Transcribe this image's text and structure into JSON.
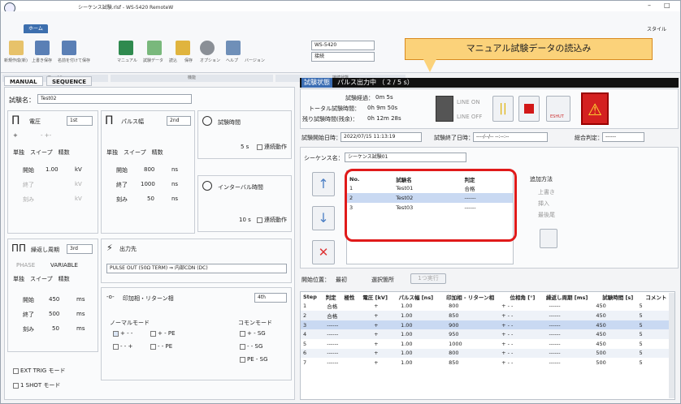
{
  "window": {
    "title": "シーケンス試験.rlsf - WS-5420 RemoteW",
    "style_menu": "スタイル",
    "home_tab": "ホーム"
  },
  "ribbon": {
    "labels": [
      "新規作成(新)",
      "上書き保存",
      "名前を付けて保存",
      "マニュアル",
      "試験データ",
      "読込",
      "保存",
      "オプション",
      "ヘルプ",
      "バージョン"
    ],
    "model_value": "WS-5420",
    "status_value": "接続",
    "groups": [
      "ファイル",
      "機能",
      "接続状態"
    ]
  },
  "callout": "マニュアル試験データの読込み",
  "left": {
    "tabs": [
      "MANUAL",
      "SEQUENCE"
    ],
    "test_name_label": "試験名：",
    "test_name_value": "Test02",
    "voltage": {
      "title": "電圧",
      "select": "1st",
      "mode_on": "+",
      "mode_off": "- +-",
      "sweep_tabs": "単独　スイープ　精数",
      "start_label": "開始",
      "start_value": "1.00",
      "start_unit": "kV",
      "end_label": "終了",
      "end_unit": "kV",
      "step_label": "刻み",
      "step_unit": "kV"
    },
    "pulse": {
      "title": "パルス幅",
      "select": "2nd",
      "sweep_tabs": "単独　スイープ　精数",
      "start_label": "開始",
      "start_value": "800",
      "start_unit": "ns",
      "end_label": "終了",
      "end_value": "1000",
      "end_unit": "ns",
      "step_label": "刻み",
      "step_unit": "ns",
      "step_value": "50"
    },
    "test_time": {
      "title": "試験時間",
      "value": "5 s",
      "cont": "連続動作"
    },
    "interval": {
      "title": "インターバル時間",
      "value": "10 s",
      "cont": "連続動作"
    },
    "period": {
      "title": "繰返し周期",
      "select": "3rd",
      "phase": "PHASE",
      "variable": "VARIABLE",
      "sweep_tabs": "単独　スイープ　精数",
      "start_label": "開始",
      "start_value": "450",
      "start_unit": "ms",
      "end_label": "終了",
      "end_value": "500",
      "end_unit": "ms",
      "step_label": "刻み",
      "step_value": "50",
      "step_unit": "ms"
    },
    "output": {
      "title": "出力先",
      "value": "PULSE OUT (50Ω TERM) ⇒ 内部CDN (DC)"
    },
    "switch": {
      "title": "印加相・リターン相",
      "select": "4th",
      "normal_mode": "ノーマルモード",
      "common_mode": "コモンモード",
      "n1": "+ - -",
      "n2": "+ - PE",
      "n3": "- - +",
      "n4": "- - PE",
      "c1": "+ - SG",
      "c2": "- - SG",
      "c3": "PE - SG"
    },
    "ext_trig": "EXT TRIG モード",
    "one_shot": "1 SHOT モード"
  },
  "right": {
    "status_label": "試験状態",
    "status_value": "パルス出力中 （ 2 / 5 s）",
    "elapsed_label": "試験経過：",
    "elapsed_value": "0m  5s",
    "total_label": "トータル試験時間：",
    "total_value": "0h  9m  50s",
    "remain_label": "残り試験時間(残余)：",
    "remain_value": "0h  12m  28s",
    "line_on": "LINE ON",
    "line_off": "LINE OFF",
    "eshut": "ESHUT",
    "start_dt_label": "試験開始日時：",
    "start_dt_value": "2022/07/15 11:13:19",
    "end_dt_label": "試験終了日時：",
    "end_dt_value": "----/--/-- --:--:--",
    "judge_label": "総合判定：",
    "judge_value": "------",
    "seq_label": "シーケンス名：",
    "seq_value": "シーケンス試験01",
    "seq_cols": [
      "No.",
      "試験名",
      "判定"
    ],
    "seq_rows": [
      [
        "1",
        "Test01",
        "合格"
      ],
      [
        "2",
        "Test02",
        "------"
      ],
      [
        "3",
        "Test03",
        "------"
      ]
    ],
    "add_method": "追加方法",
    "add_options": [
      "上書き",
      "挿入",
      "最後尾"
    ],
    "start_pos_label": "開始位置：",
    "start_pos_first": "最初",
    "start_pos_sel": "選択箇所",
    "single_btn": "1つ実行",
    "step_cols": [
      "Step",
      "判定",
      "極性",
      "電圧 [kV]",
      "パルス幅 [ns]",
      "印加相 - リターン相",
      "位相角 [°]",
      "繰返し周期 [ms]",
      "試験時間 [s]",
      "コメント"
    ],
    "step_rows": [
      [
        "1",
        "合格",
        "+",
        "1.00",
        "800",
        "+ - -",
        "------",
        "450",
        "5",
        ""
      ],
      [
        "2",
        "合格",
        "+",
        "1.00",
        "850",
        "+ - -",
        "------",
        "450",
        "5",
        ""
      ],
      [
        "3",
        "------",
        "+",
        "1.00",
        "900",
        "+ - -",
        "------",
        "450",
        "5",
        ""
      ],
      [
        "4",
        "------",
        "+",
        "1.00",
        "950",
        "+ - -",
        "------",
        "450",
        "5",
        ""
      ],
      [
        "5",
        "------",
        "+",
        "1.00",
        "1000",
        "+ - -",
        "------",
        "450",
        "5",
        ""
      ],
      [
        "6",
        "------",
        "+",
        "1.00",
        "800",
        "+ - -",
        "------",
        "500",
        "5",
        ""
      ],
      [
        "7",
        "------",
        "+",
        "1.00",
        "850",
        "+ - -",
        "------",
        "500",
        "5",
        ""
      ]
    ]
  }
}
